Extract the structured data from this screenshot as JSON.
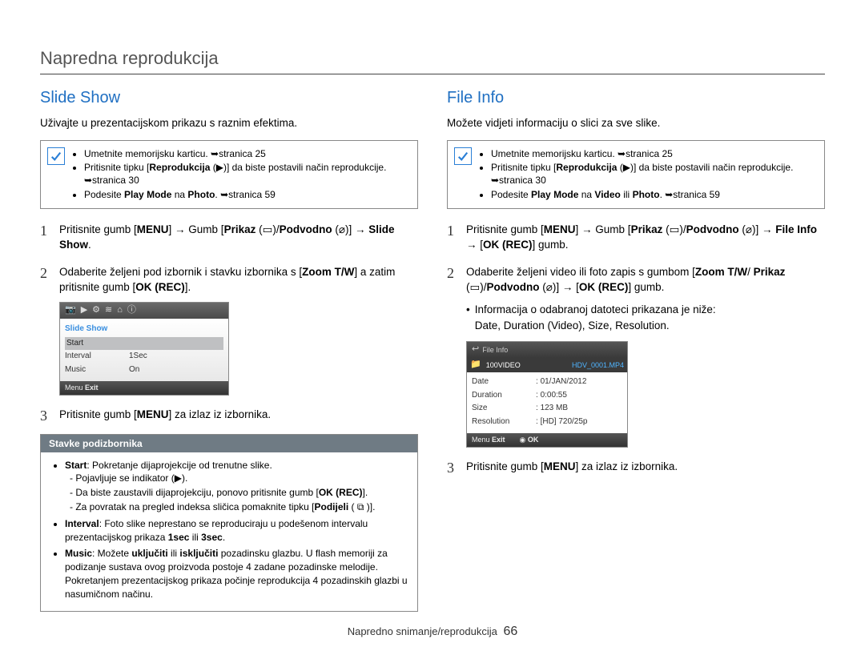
{
  "page_title": "Napredna reprodukcija",
  "footer": {
    "section": "Napredno snimanje/reprodukcija",
    "page": "66"
  },
  "left": {
    "heading": "Slide Show",
    "intro": "Uživajte u prezentacijskom prikazu s raznim efektima.",
    "notes": [
      "Umetnite memorijsku karticu. ➥stranica 25",
      "Pritisnite tipku [Reprodukcija (▶)] da biste postavili način reprodukcije. ➥stranica 30",
      "Podesite Play Mode na Photo. ➥stranica 59"
    ],
    "step1_a": "Pritisnite gumb [",
    "step1_b": "] → Gumb [",
    "step1_c": " (▭)/",
    "step1_d": " (⌀)] → ",
    "step1_menu": "MENU",
    "step1_gumb_label": "Prikaz",
    "step1_podvodno": "Podvodno",
    "step1_target": "Slide Show",
    "step1_end": ".",
    "step2": "Odaberite željeni pod izbornik i stavku izbornika s [Zoom T/W] a zatim pritisnite gumb [OK (REC)].",
    "step3_a": "Pritisnite gumb [",
    "step3_menu": "MENU",
    "step3_b": "] za izlaz iz izbornika.",
    "screenshot": {
      "title": "Slide Show",
      "rows": [
        {
          "k": "Start",
          "v": ""
        },
        {
          "k": "Interval",
          "v": "1Sec"
        },
        {
          "k": "Music",
          "v": "On"
        }
      ],
      "foot_exit": "Exit",
      "foot_menu": "Menu"
    },
    "sub_box": {
      "title": "Stavke podizbornika",
      "items": [
        {
          "k": "Start",
          "text": "Pokretanje dijaprojekcije od trenutne slike.",
          "sub": [
            "Pojavljuje se indikator (▶).",
            "Da biste zaustavili dijaprojekciju, ponovo pritisnite gumb [OK (REC)].",
            "Za povratak na pregled indeksa sličica pomaknite tipku [Podijeli ( ⧉ )]."
          ]
        },
        {
          "k": "Interval",
          "text": "Foto slike neprestano se reproduciraju u podešenom intervalu prezentacijskog prikaza 1sec ili 3sec."
        },
        {
          "k": "Music",
          "text": "Možete uključiti ili isključiti pozadinsku glazbu. U flash memoriji za podizanje sustava ovog proizvoda postoje 4 zadane pozadinske melodije. Pokretanjem prezentacijskog prikaza počinje reprodukcija 4 pozadinskih glazbi u nasumičnom načinu."
        }
      ]
    }
  },
  "right": {
    "heading": "File Info",
    "intro": "Možete vidjeti informaciju o slici za sve slike.",
    "notes": [
      "Umetnite memorijsku karticu. ➥stranica 25",
      "Pritisnite tipku [Reprodukcija (▶)] da biste postavili način reprodukcije. ➥stranica 30",
      "Podesite Play Mode na Video ili Photo. ➥stranica 59"
    ],
    "step1_menu": "MENU",
    "step1_gumb_label": "Prikaz",
    "step1_podvodno": "Podvodno",
    "step1_target": "File Info",
    "step1_ok": "OK (REC)",
    "step1_gumb": "] gumb.",
    "step2_a": "Odaberite željeni video ili foto zapis s gumbom [",
    "step2_zoom": "Zoom T/W",
    "step2_b": "/ ",
    "step2_prikaz": "Prikaz",
    "step2_c": " (▭)/",
    "step2_podvodno": "Podvodno",
    "step2_d": " (⌀)] → [",
    "step2_ok": "OK (REC)",
    "step2_e": "] gumb.",
    "step2_bullet_lead": "Informacija o odabranoj datoteci prikazana je niže:",
    "step2_fields": "Date, Duration (Video), Size, Resolution.",
    "step3_menu": "MENU",
    "step3_a": "Pritisnite gumb [",
    "step3_b": "] za izlaz iz izbornika.",
    "screenshot": {
      "header": "File Info",
      "folder": "100VIDEO",
      "filename": "HDV_0001.MP4",
      "rows": [
        {
          "k": "Date",
          "v": "01/JAN/2012"
        },
        {
          "k": "Duration",
          "v": "0:00:55"
        },
        {
          "k": "Size",
          "v": "123 MB"
        },
        {
          "k": "Resolution",
          "v": "[HD] 720/25p"
        }
      ],
      "foot_exit": "Exit",
      "foot_ok": "OK",
      "foot_menu": "Menu"
    }
  }
}
